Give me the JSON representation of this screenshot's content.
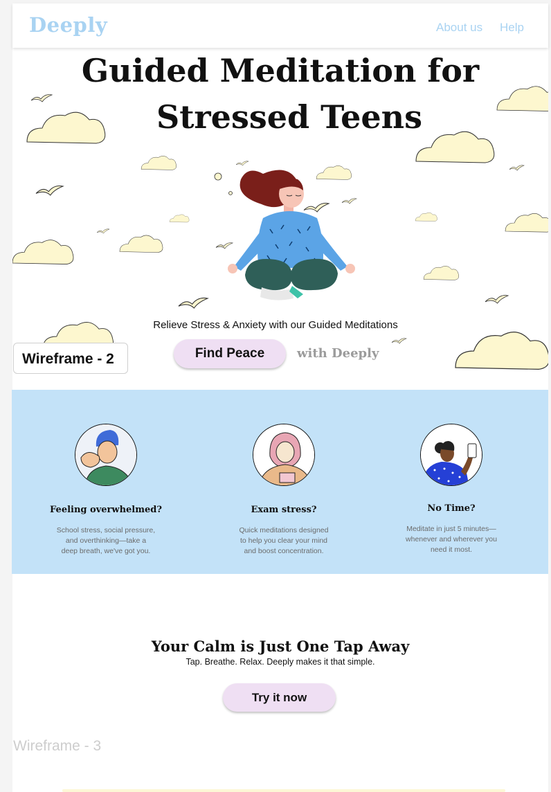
{
  "nav": {
    "logo": "Deeply",
    "links": [
      "About us",
      "Help"
    ]
  },
  "hero": {
    "title_line1": "Guided Meditation for",
    "title_line2": "Stressed Teens",
    "tagline": "Relieve Stress & Anxiety with our Guided Meditations",
    "cta_label": "Find Peace",
    "with_text": "with Deeply"
  },
  "wireframe_labels": {
    "wf2": "Wireframe - 2",
    "wf3": "Wireframe - 3"
  },
  "features": [
    {
      "title": "Feeling overwhelmed?",
      "desc": [
        "School stress, social pressure,",
        "and overthinking—take a",
        "deep breath, we've got you."
      ]
    },
    {
      "title": "Exam stress?",
      "desc": [
        "Quick meditations designed",
        "to help you clear your mind",
        "and boost concentration."
      ]
    },
    {
      "title": "No Time?",
      "desc": [
        "Meditate in just 5 minutes—",
        "whenever and wherever you",
        "need it most."
      ]
    }
  ],
  "cta": {
    "title": "Your Calm is Just One Tap Away",
    "subtitle": "Tap. Breathe. Relax. Deeply makes it that simple.",
    "button": "Try it now"
  },
  "colors": {
    "accent_blue": "#a9d3f2",
    "section_blue": "#c3e2f8",
    "button_pink": "#efdff3",
    "cloud_yellow": "#fdf7cf"
  },
  "icons": [
    "cloud-icon",
    "bird-icon",
    "meditating-girl-illustration"
  ]
}
